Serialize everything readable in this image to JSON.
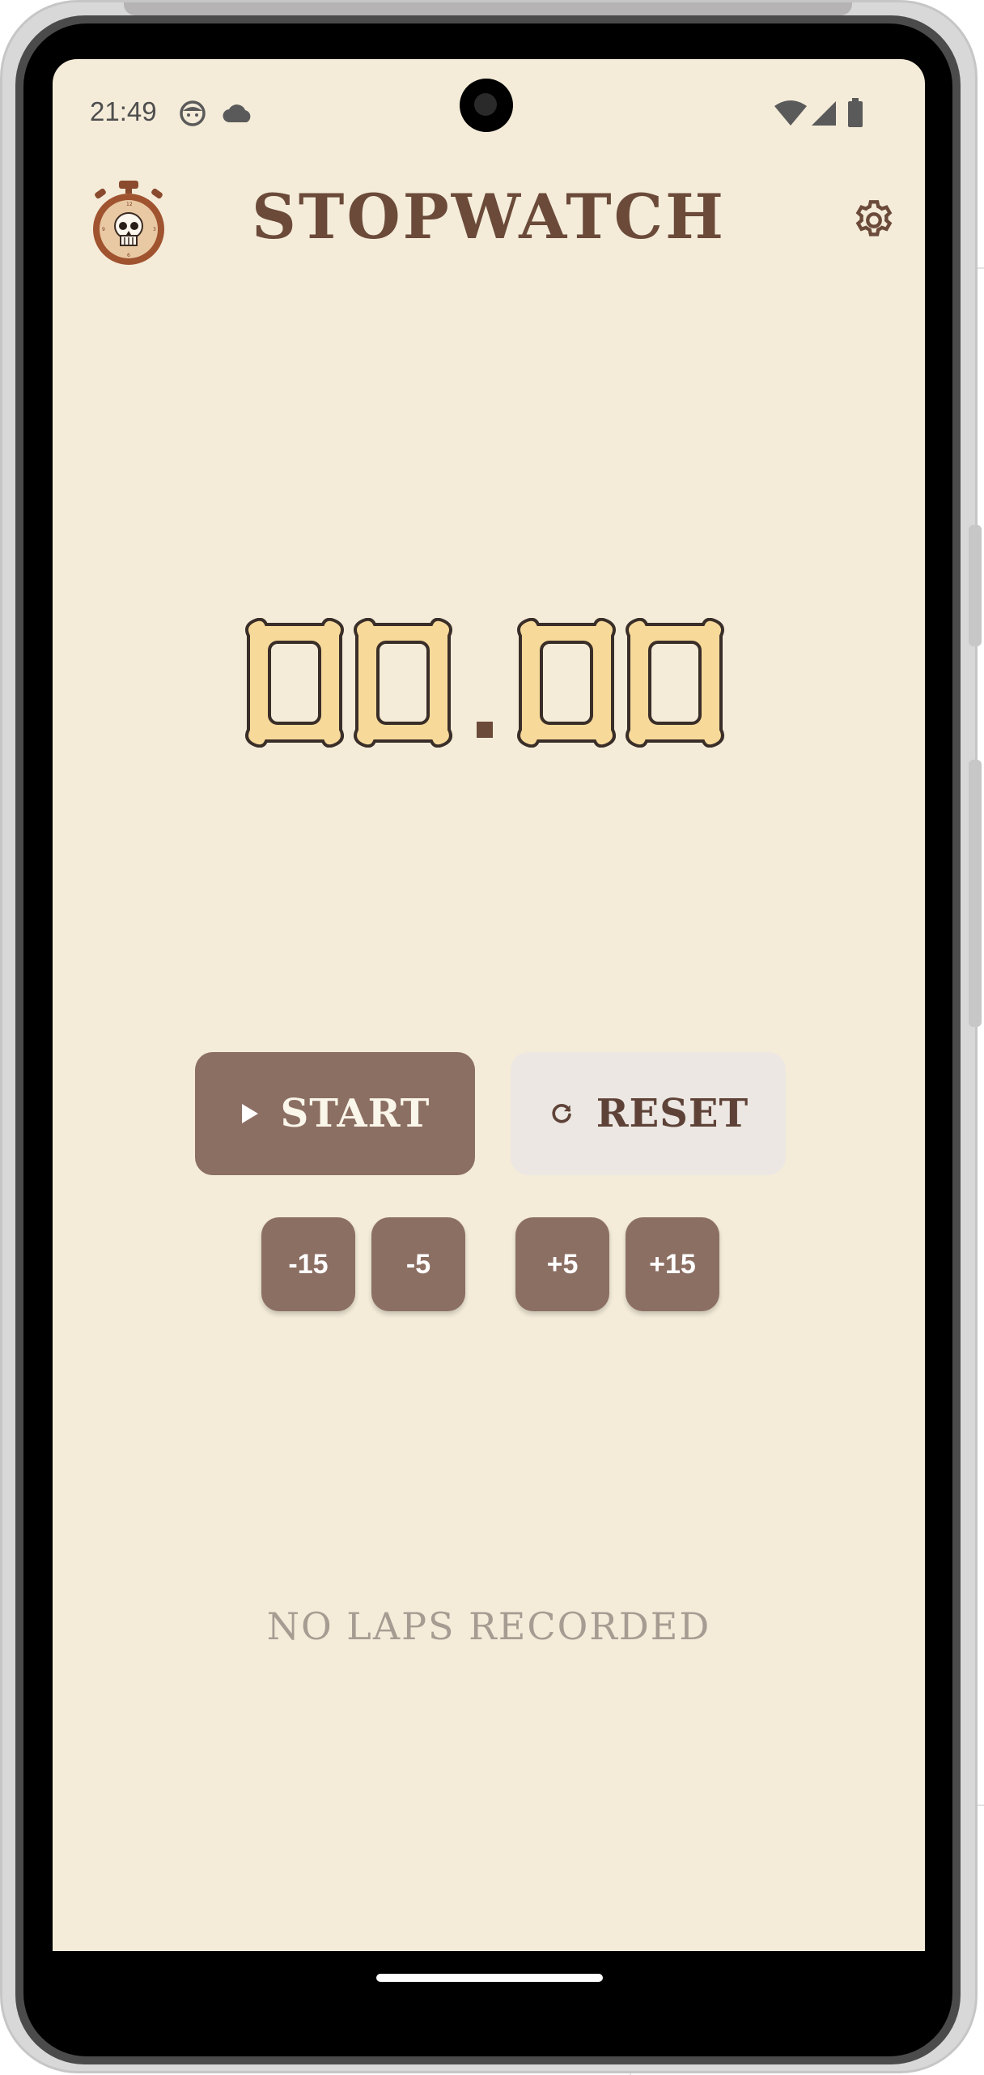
{
  "status_bar": {
    "time": "21:49",
    "icons": [
      "face-icon",
      "cloud-icon",
      "wifi-icon",
      "signal-icon",
      "battery-icon"
    ]
  },
  "header": {
    "title": "STOPWATCH",
    "app_icon": "skull-stopwatch-icon",
    "settings_icon": "gear-icon"
  },
  "timer": {
    "display": "00.00",
    "digits": [
      "0",
      "0",
      "0",
      "0"
    ],
    "separator": "."
  },
  "controls": {
    "start_label": "START",
    "start_icon": "play-icon",
    "reset_label": "RESET",
    "reset_icon": "refresh-icon",
    "adjust": [
      "-15",
      "-5",
      "+5",
      "+15"
    ]
  },
  "laps": {
    "empty_text": "NO LAPS RECORDED"
  },
  "colors": {
    "background": "#f4ecd9",
    "primary": "#8c6f63",
    "secondary": "#ece7e2",
    "title_text": "#6b4a3a",
    "bone": "#f7d99a",
    "muted_text": "#a69c92"
  }
}
